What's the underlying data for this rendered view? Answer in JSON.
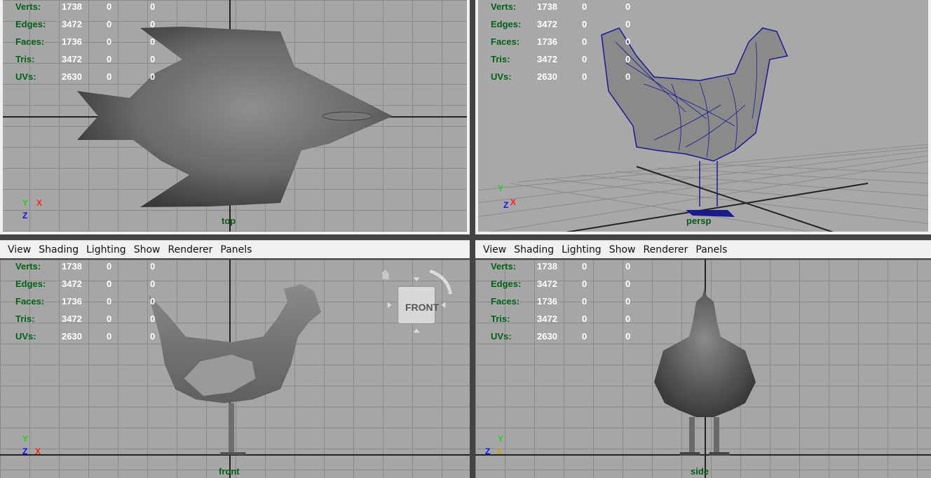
{
  "stats": {
    "rows": [
      {
        "label": "Verts:",
        "v1": "1738",
        "v2": "0",
        "v3": "0"
      },
      {
        "label": "Edges:",
        "v1": "3472",
        "v2": "0",
        "v3": "0"
      },
      {
        "label": "Faces:",
        "v1": "1736",
        "v2": "0",
        "v3": "0"
      },
      {
        "label": "Tris:",
        "v1": "3472",
        "v2": "0",
        "v3": "0"
      },
      {
        "label": "UVs:",
        "v1": "2630",
        "v2": "0",
        "v3": "0"
      }
    ]
  },
  "menu": [
    "View",
    "Shading",
    "Lighting",
    "Show",
    "Renderer",
    "Panels"
  ],
  "viewports": {
    "top": {
      "label": "top"
    },
    "persp": {
      "label": "persp"
    },
    "front": {
      "label": "front"
    },
    "side": {
      "label": "side"
    }
  },
  "axes": {
    "x": "X",
    "y": "Y",
    "z": "Z"
  },
  "viewcube": {
    "face_label": "FRONT"
  },
  "colors": {
    "viewport_bg": "#a6a6a6",
    "grid": "#8a8a8a",
    "hud_label": "#06601a",
    "wireframe": "#1a1a8c"
  }
}
